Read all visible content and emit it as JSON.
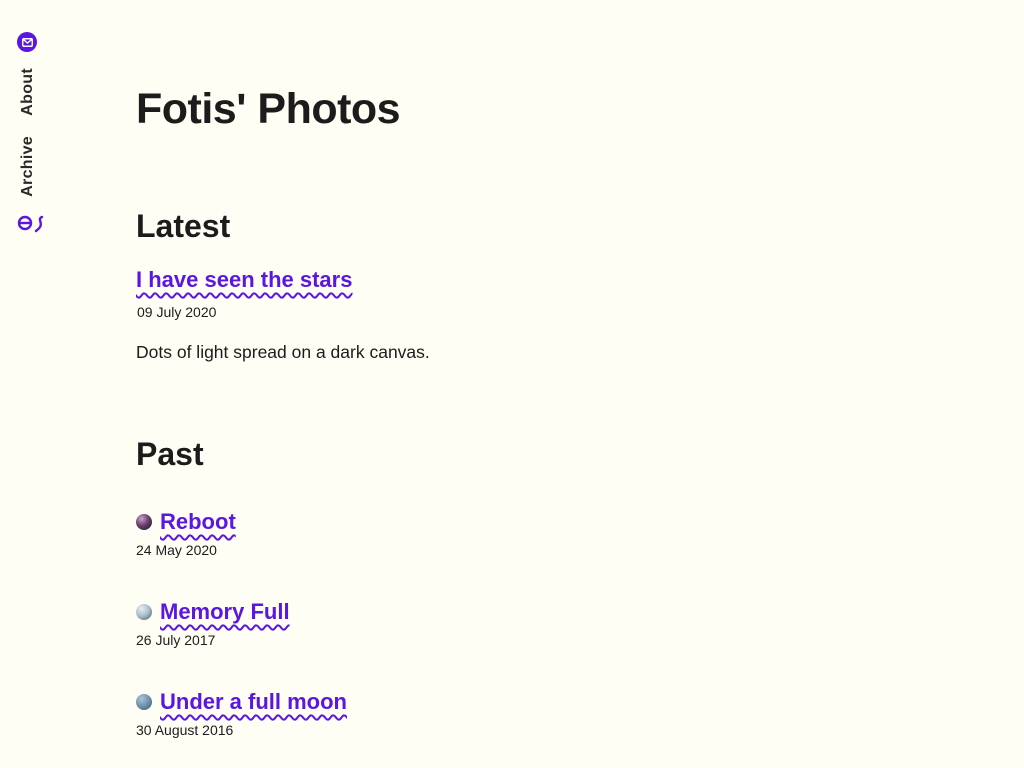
{
  "sidebar": {
    "mail_icon": "envelope-icon",
    "nav": [
      {
        "label": "About"
      },
      {
        "label": "Archive"
      }
    ],
    "logo_icon": "site-logo-icon",
    "accent_color": "#5b16e0"
  },
  "main": {
    "title": "Fotis' Photos",
    "latest": {
      "heading": "Latest",
      "post": {
        "title": "I have seen the stars",
        "date": "09 July 2020",
        "description": "Dots of light spread on a dark canvas."
      }
    },
    "past": {
      "heading": "Past",
      "items": [
        {
          "title": "Reboot",
          "date": "24 May 2020"
        },
        {
          "title": "Memory Full",
          "date": "26 July 2017"
        },
        {
          "title": "Under a full moon",
          "date": "30 August 2016"
        }
      ]
    }
  }
}
